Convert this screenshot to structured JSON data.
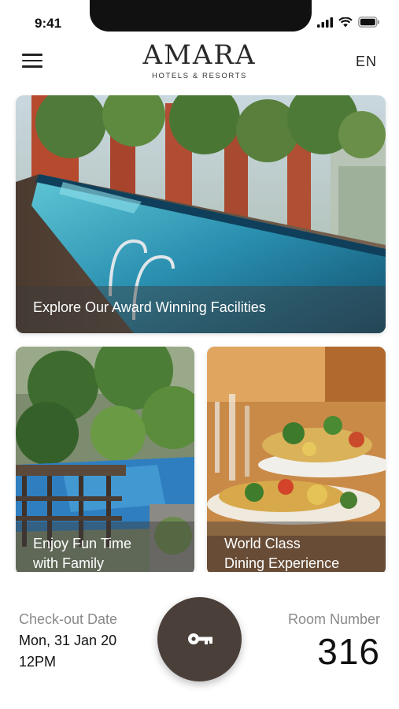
{
  "status_bar": {
    "time": "9:41"
  },
  "header": {
    "logo_text": "AMARA",
    "logo_subtitle": "HOTELS & RESORTS",
    "language": "EN"
  },
  "cards": [
    {
      "caption": "Explore Our Award Winning Facilities"
    },
    {
      "caption_line1": "Enjoy Fun Time",
      "caption_line2": "with Family"
    },
    {
      "caption_line1": "World Class",
      "caption_line2": "Dining Experience"
    }
  ],
  "booking": {
    "checkout_label": "Check-out Date",
    "checkout_date": "Mon, 31 Jan 20",
    "checkout_time": "12PM",
    "room_label": "Room Number",
    "room_number": "316"
  },
  "colors": {
    "key_button": "#4a3f39",
    "caption_band": "rgba(60,60,60,0.45)",
    "muted_text": "#8a8a8a"
  },
  "icons": [
    "menu-icon",
    "signal-icon",
    "wifi-icon",
    "battery-icon",
    "key-icon"
  ]
}
